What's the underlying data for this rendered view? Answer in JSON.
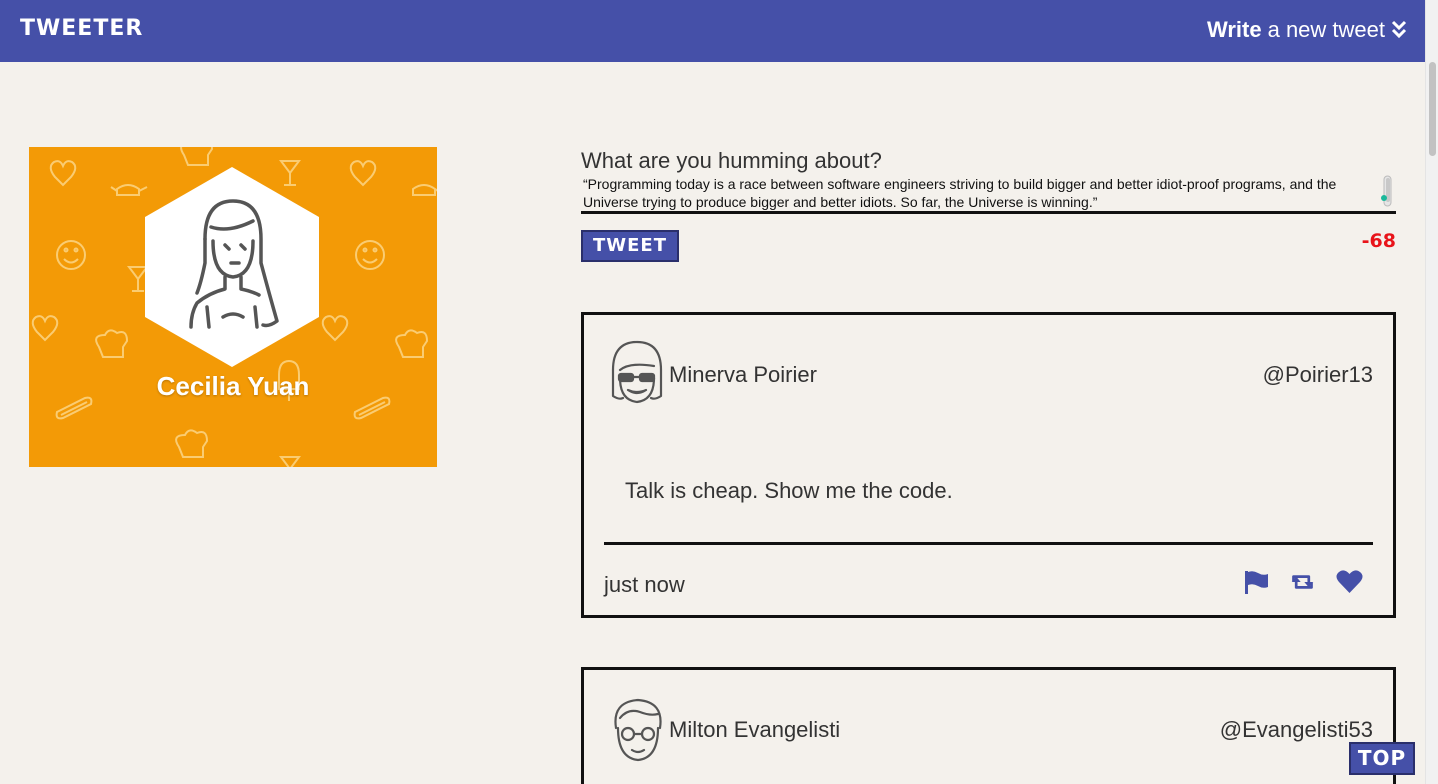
{
  "nav": {
    "brand": "TWEETER",
    "write_bold": "Write",
    "write_rest": "a new tweet",
    "toggle_icon": "double-chevron-down-icon"
  },
  "colors": {
    "nav_bg": "#4550a8",
    "profile_bg": "#f39a06",
    "page_bg": "#f4f1ec",
    "counter": "#e8141a",
    "icon_accent": "#4550a8"
  },
  "profile": {
    "name": "Cecilia Yuan",
    "avatar_icon": "woman-avatar-icon"
  },
  "compose": {
    "label": "What are you humming about?",
    "value": "“Programming today is a race between software engineers striving to build bigger and better idiot-proof programs, and the Universe trying to produce bigger and better idiots. So far, the Universe is winning.”",
    "button_label": "TWEET",
    "counter": "-68"
  },
  "tweets": [
    {
      "author": "Minerva Poirier",
      "handle": "@Poirier13",
      "content": "Talk is cheap. Show me the code.",
      "timestamp": "just now",
      "avatar_icon": "girl-sunglasses-avatar-icon",
      "actions": [
        "flag-icon",
        "retweet-icon",
        "heart-icon"
      ]
    },
    {
      "author": "Milton Evangelisti",
      "handle": "@Evangelisti53",
      "avatar_icon": "man-glasses-avatar-icon"
    }
  ],
  "top_button": "TOP"
}
